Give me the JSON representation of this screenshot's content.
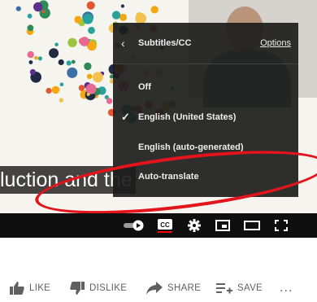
{
  "caption": {
    "text": "luction and the"
  },
  "menu": {
    "title": "Subtitles/CC",
    "options_link": "Options",
    "items": [
      {
        "label": "Off",
        "selected": false
      },
      {
        "label": "English (United States)",
        "selected": true
      },
      {
        "label": "English (auto-generated)",
        "selected": false
      },
      {
        "label": "Auto-translate",
        "selected": false
      }
    ]
  },
  "controls": {
    "icons": [
      "autoplay-toggle-icon",
      "captions-icon",
      "settings-gear-icon",
      "miniplayer-icon",
      "theater-mode-icon",
      "fullscreen-icon"
    ],
    "captions_icon_text": "CC",
    "captions_active_color": "#ff0000"
  },
  "annotation": {
    "ring_color": "#e3141b"
  },
  "actions": {
    "like": "LIKE",
    "dislike": "DISLIKE",
    "share": "SHARE",
    "save": "SAVE",
    "more": "..."
  }
}
